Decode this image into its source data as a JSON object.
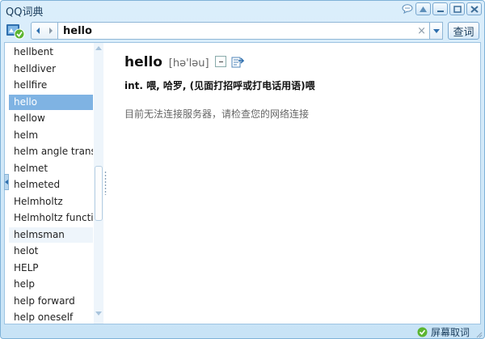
{
  "window": {
    "title": "QQ词典",
    "window_buttons": [
      "feedback-icon",
      "skin-icon",
      "minimize-icon",
      "maximize-icon",
      "close-icon"
    ]
  },
  "toolbar": {
    "search_value": "hello",
    "clear_symbol": "×",
    "lookup_label": "查词",
    "accent": "#7fb3e3"
  },
  "wordlist": {
    "items": [
      "hellbent",
      "helldiver",
      "hellfire",
      "hello",
      "hellow",
      "helm",
      "helm angle transmitter",
      "helmet",
      "helmeted",
      "Helmholtz",
      "Helmholtz function",
      "helmsman",
      "helot",
      "HELP",
      "help",
      "help forward",
      "help oneself"
    ],
    "selected_index": 3,
    "hover_index": 11
  },
  "definition": {
    "headword": "hello",
    "phonetic": "[hə'ləu]",
    "meaning": "int. 喂, 哈罗, (见面打招呼或打电话用语)喂",
    "notice": "目前无法连接服务器，请检查您的网络连接"
  },
  "statusbar": {
    "screen_word_label": "屏幕取词"
  }
}
